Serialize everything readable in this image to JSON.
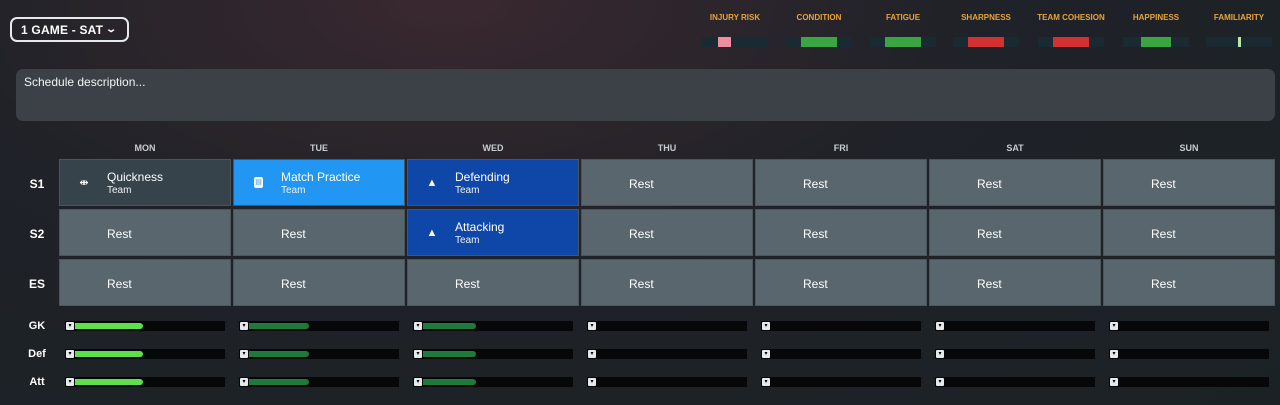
{
  "selector": {
    "label": "1 GAME - SAT",
    "chevron_icon": "chevron-down-icon"
  },
  "metrics": [
    {
      "label": "INJURY RISK",
      "color": "#ee8da0",
      "value": 0.2
    },
    {
      "label": "CONDITION",
      "color": "#3aa642",
      "value": 0.55
    },
    {
      "label": "FATIGUE",
      "color": "#3aa642",
      "value": 0.55
    },
    {
      "label": "SHARPNESS",
      "color": "#d2312f",
      "value": 0.55
    },
    {
      "label": "TEAM COHESION",
      "color": "#d2312f",
      "value": 0.55
    },
    {
      "label": "HAPPINESS",
      "color": "#3aa642",
      "value": 0.45
    },
    {
      "label": "FAMILIARITY",
      "color": "#b8e6a8",
      "value": 0.04
    }
  ],
  "description": {
    "placeholder": "Schedule description..."
  },
  "days": [
    "MON",
    "TUE",
    "WED",
    "THU",
    "FRI",
    "SAT",
    "SUN"
  ],
  "rows": [
    {
      "label": "S1",
      "cells": [
        {
          "title": "Quickness",
          "sub": "Team",
          "style": "dark",
          "icon": "quickness-icon"
        },
        {
          "title": "Match Practice",
          "sub": "Team",
          "style": "blue",
          "icon": "match-practice-icon"
        },
        {
          "title": "Defending",
          "sub": "Team",
          "style": "navy",
          "icon": "training-cone-icon"
        },
        {
          "title": "Rest"
        },
        {
          "title": "Rest"
        },
        {
          "title": "Rest"
        },
        {
          "title": "Rest"
        }
      ]
    },
    {
      "label": "S2",
      "cells": [
        {
          "title": "Rest"
        },
        {
          "title": "Rest"
        },
        {
          "title": "Attacking",
          "sub": "Team",
          "style": "navy",
          "icon": "training-cone-icon"
        },
        {
          "title": "Rest"
        },
        {
          "title": "Rest"
        },
        {
          "title": "Rest"
        },
        {
          "title": "Rest"
        }
      ]
    },
    {
      "label": "ES",
      "cells": [
        {
          "title": "Rest"
        },
        {
          "title": "Rest"
        },
        {
          "title": "Rest"
        },
        {
          "title": "Rest"
        },
        {
          "title": "Rest"
        },
        {
          "title": "Rest"
        },
        {
          "title": "Rest"
        }
      ]
    }
  ],
  "load": {
    "groups": [
      "GK",
      "Def",
      "Att"
    ],
    "pin_icon": "pin-icon",
    "days": [
      {
        "value": 0.45,
        "color": "#5de04a"
      },
      {
        "value": 0.4,
        "color": "#1e7a3a"
      },
      {
        "value": 0.35,
        "color": "#1e7a3a"
      },
      {
        "value": 0,
        "color": "#1e7a3a"
      },
      {
        "value": 0,
        "color": "#1e7a3a"
      },
      {
        "value": 0,
        "color": "#1e7a3a"
      },
      {
        "value": 0,
        "color": "#1e7a3a"
      }
    ]
  }
}
